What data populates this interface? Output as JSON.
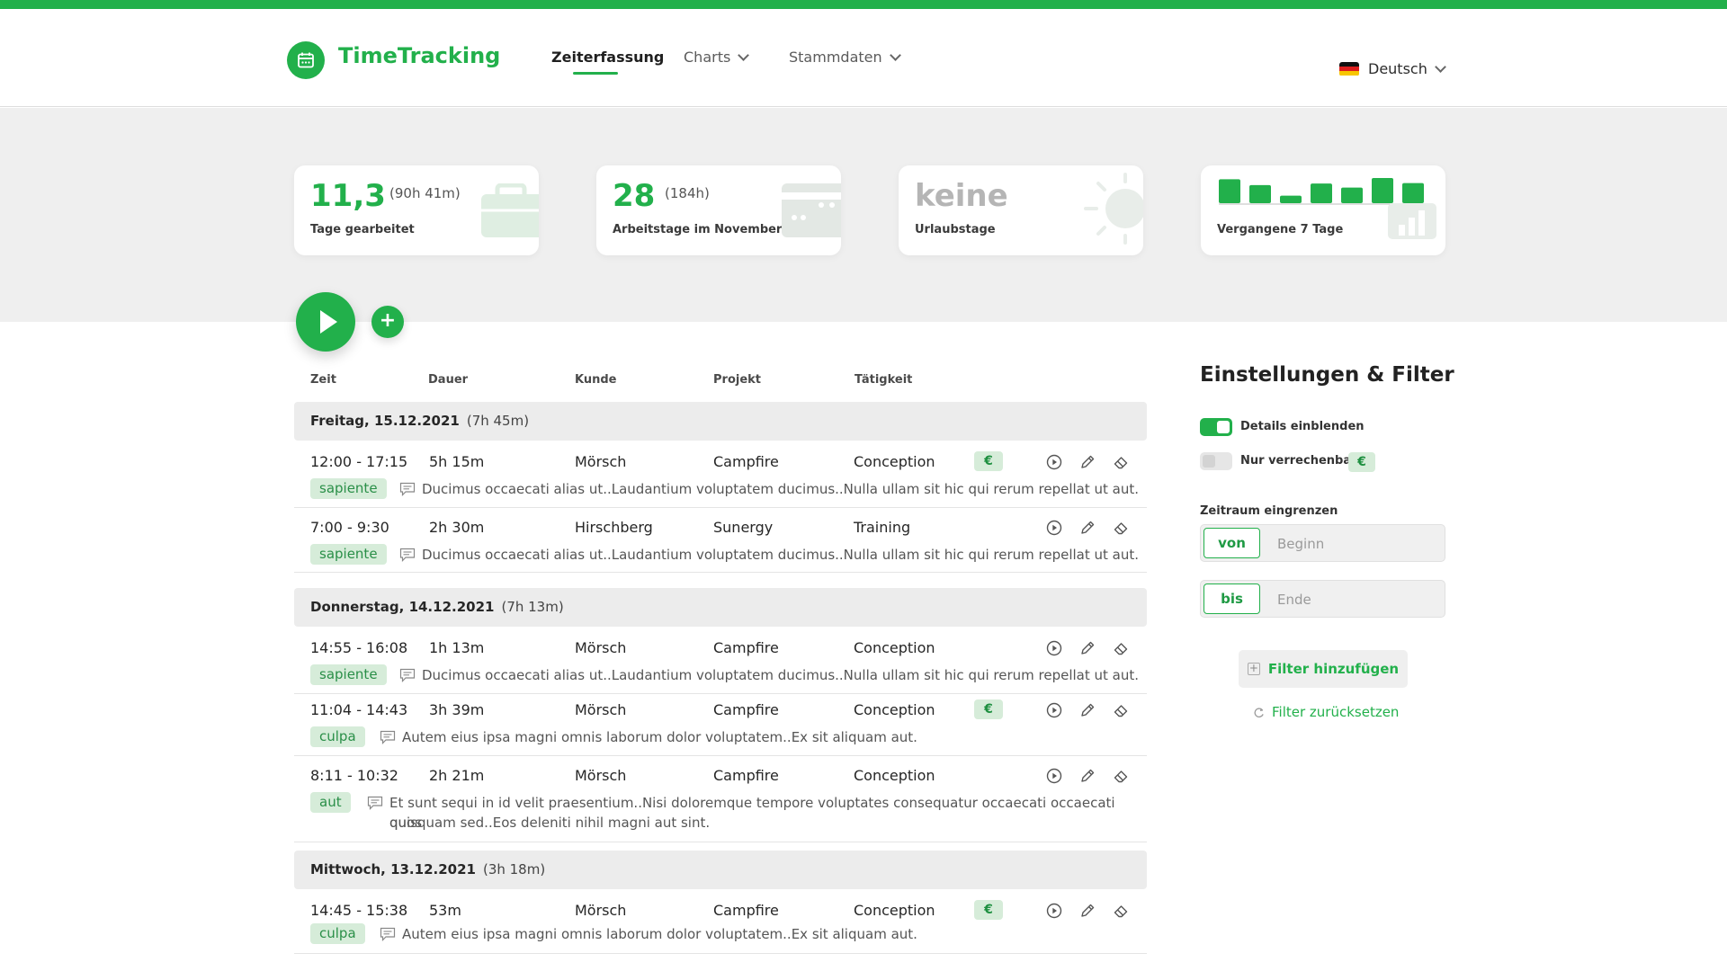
{
  "colors": {
    "accent": "#22b04b",
    "hero_bg": "#efefef",
    "tag_bg": "#d6ecd9"
  },
  "brand": {
    "name": "TimeTracking",
    "icon": "calendar-icon"
  },
  "nav": [
    {
      "label": "Zeiterfassung",
      "active": true
    },
    {
      "label": "Charts"
    },
    {
      "label": "Stammdaten"
    }
  ],
  "language": "Deutsch",
  "stats": [
    {
      "value": "11,3",
      "sub": "(90h 41m)",
      "label": "Tage gearbeitet",
      "icon": "briefcase-icon"
    },
    {
      "value": "28",
      "sub": "(184h)",
      "label": "Arbeitstage im November",
      "icon": "credit-card-icon"
    },
    {
      "value": "keine",
      "label": "Urlaubstage",
      "icon": "sun-icon"
    },
    {
      "label": "Vergangene 7 Tage",
      "icon": "bar-chart-icon",
      "bars": [
        0.95,
        0.72,
        0.3,
        0.78,
        0.62,
        1.0,
        0.8
      ]
    }
  ],
  "columns": [
    "Zeit",
    "Dauer",
    "Kunde",
    "Projekt",
    "Tätigkeit"
  ],
  "days": [
    {
      "date": "Freitag, 15.12.2021",
      "hours": "(7h 45m)",
      "entries": [
        {
          "time": "12:00 - 17:15",
          "duration": "5h 15m",
          "client": "Mörsch",
          "project": "Campfire",
          "activity": "Conception",
          "billable": true,
          "tag": "sapiente",
          "note": "Ducimus occaecati alias ut..Laudantium voluptatem ducimus..Nulla ullam sit hic qui rerum repellat ut aut."
        },
        {
          "time": "7:00 - 9:30",
          "duration": "2h 30m",
          "client": "Hirschberg",
          "project": "Sunergy",
          "activity": "Training",
          "billable": false,
          "tag": "sapiente",
          "note": "Ducimus occaecati alias ut..Laudantium voluptatem ducimus..Nulla ullam sit hic qui rerum repellat ut aut."
        }
      ]
    },
    {
      "date": "Donnerstag, 14.12.2021",
      "hours": "(7h 13m)",
      "entries": [
        {
          "time": "14:55 - 16:08",
          "duration": "1h 13m",
          "client": "Mörsch",
          "project": "Campfire",
          "activity": "Conception",
          "billable": false,
          "tag": "sapiente",
          "note": "Ducimus occaecati alias ut..Laudantium voluptatem ducimus..Nulla ullam sit hic qui rerum repellat ut aut."
        },
        {
          "time": "11:04 - 14:43",
          "duration": "3h 39m",
          "client": "Mörsch",
          "project": "Campfire",
          "activity": "Conception",
          "billable": true,
          "tag": "culpa",
          "note": "Autem eius ipsa magni omnis laborum dolor voluptatem..Ex sit aliquam aut."
        },
        {
          "time": "8:11 - 10:32",
          "duration": "2h 21m",
          "client": "Mörsch",
          "project": "Campfire",
          "activity": "Conception",
          "billable": false,
          "tag": "aut",
          "note": "Et sunt sequi in id velit praesentium..Nisi doloremque tempore voluptates consequatur occaecati occaecati quos",
          "note2": "quisquam sed..Eos deleniti nihil magni aut sint."
        }
      ]
    },
    {
      "date": "Mittwoch, 13.12.2021",
      "hours": "(3h 18m)",
      "entries": [
        {
          "time": "14:45 - 15:38",
          "duration": "53m",
          "client": "Mörsch",
          "project": "Campfire",
          "activity": "Conception",
          "billable": true,
          "tag": "culpa",
          "note": "Autem eius ipsa magni omnis laborum dolor voluptatem..Ex sit aliquam aut."
        }
      ]
    }
  ],
  "euro_symbol": "€",
  "filters": {
    "title": "Einstellungen & Filter",
    "details_label": "Details einblenden",
    "details_on": true,
    "billable_label": "Nur verrechenbar",
    "billable_on": false,
    "range_label": "Zeitraum eingrenzen",
    "from_label": "von",
    "from_placeholder": "Beginn",
    "to_label": "bis",
    "to_placeholder": "Ende",
    "add_label": "Filter hinzufügen",
    "reset_label": "Filter zurücksetzen"
  }
}
